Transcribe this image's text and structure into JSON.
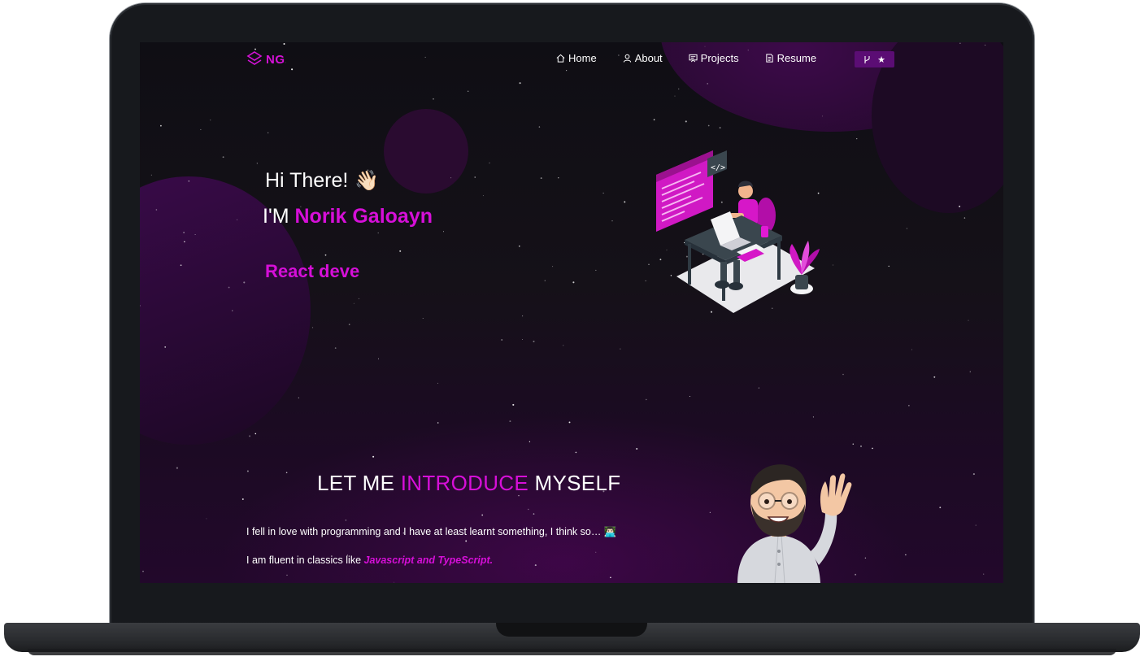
{
  "nav": {
    "logo_text": "NG",
    "items": [
      {
        "label": "Home",
        "icon": "home-icon"
      },
      {
        "label": "About",
        "icon": "user-icon"
      },
      {
        "label": "Projects",
        "icon": "projects-icon"
      },
      {
        "label": "Resume",
        "icon": "document-icon"
      }
    ],
    "fork_star": "★"
  },
  "hero": {
    "greeting": "Hi There!",
    "wave": "👋🏻",
    "im_prefix": "I'M ",
    "name": "Norik Galoayn",
    "typed_role": "React deve"
  },
  "intro": {
    "title_a": "LET ME ",
    "title_b": "INTRODUCE",
    "title_c": " MYSELF",
    "p1": "I fell in love with programming and I have at least learnt something, I think so… 👨🏻‍💻",
    "p2_prefix": "I am fluent in classics like ",
    "p2_emphasis": "Javascript and TypeScript."
  },
  "colors": {
    "accent": "#d60fd8",
    "button": "#5b0d74",
    "background": "#151118"
  }
}
